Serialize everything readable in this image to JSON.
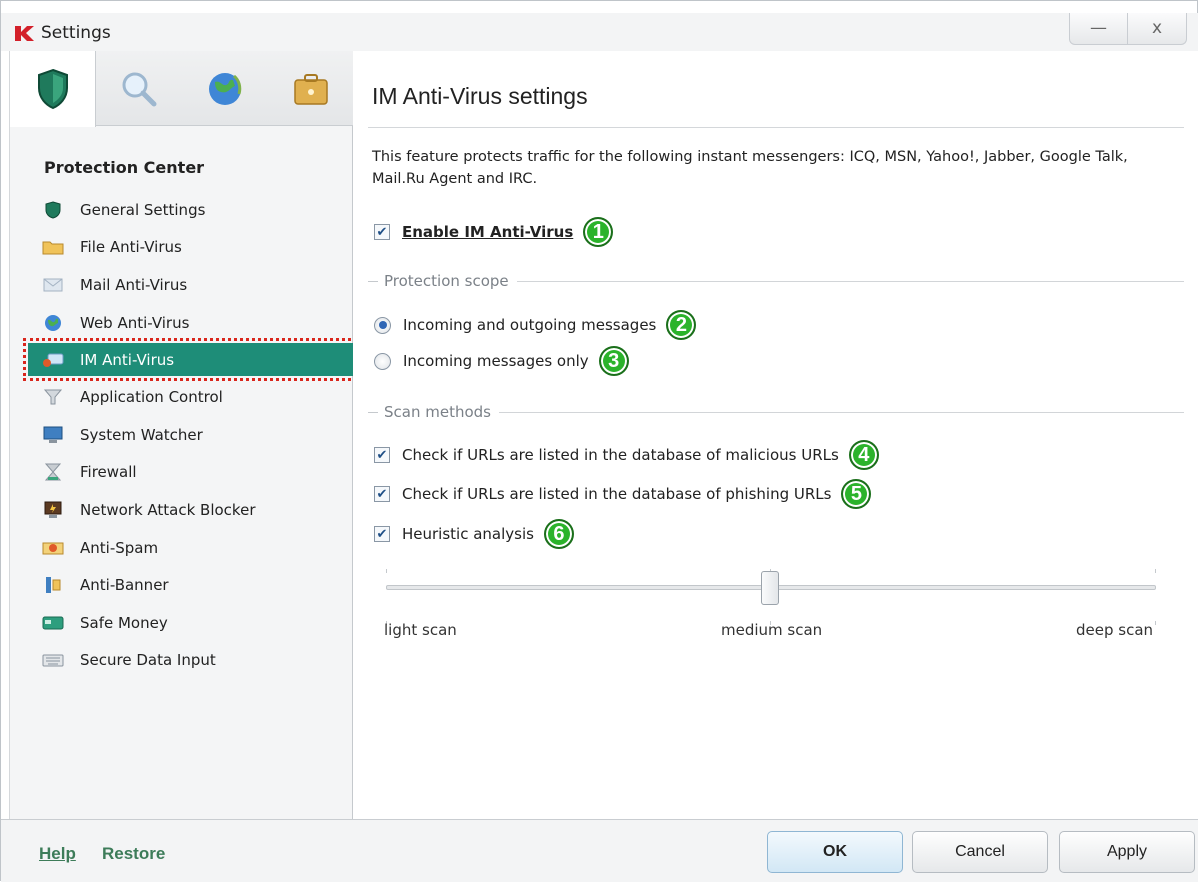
{
  "window": {
    "title": "Settings",
    "minimize": "—",
    "close": "x"
  },
  "sidebar": {
    "tabs": [
      {
        "icon": "shield-icon"
      },
      {
        "icon": "magnifier-icon"
      },
      {
        "icon": "globe-icon"
      },
      {
        "icon": "briefcase-icon"
      }
    ],
    "section_title": "Protection Center",
    "items": [
      {
        "label": "General Settings",
        "icon": "shield-icon"
      },
      {
        "label": "File Anti-Virus",
        "icon": "folder-icon"
      },
      {
        "label": "Mail Anti-Virus",
        "icon": "envelope-icon"
      },
      {
        "label": "Web Anti-Virus",
        "icon": "globe-icon"
      },
      {
        "label": "IM Anti-Virus",
        "icon": "chat-icon",
        "selected": true
      },
      {
        "label": "Application Control",
        "icon": "funnel-icon"
      },
      {
        "label": "System Watcher",
        "icon": "monitor-icon"
      },
      {
        "label": "Firewall",
        "icon": "hourglass-icon"
      },
      {
        "label": "Network Attack Blocker",
        "icon": "network-icon"
      },
      {
        "label": "Anti-Spam",
        "icon": "spam-icon"
      },
      {
        "label": "Anti-Banner",
        "icon": "banner-icon"
      },
      {
        "label": "Safe Money",
        "icon": "card-icon"
      },
      {
        "label": "Secure Data Input",
        "icon": "keyboard-icon"
      }
    ]
  },
  "main": {
    "title": "IM Anti-Virus settings",
    "description": "This feature protects traffic for the following instant messengers: ICQ, MSN, Yahoo!, Jabber, Google Talk, Mail.Ru Agent and IRC.",
    "enable": {
      "label": "Enable IM Anti-Virus",
      "checked": true,
      "badge": "1"
    },
    "protection_scope": {
      "label": "Protection scope",
      "options": [
        {
          "label": "Incoming and outgoing messages",
          "selected": true,
          "badge": "2"
        },
        {
          "label": "Incoming messages only",
          "selected": false,
          "badge": "3"
        }
      ]
    },
    "scan_methods": {
      "label": "Scan methods",
      "options": [
        {
          "label": "Check if URLs are listed in the database of malicious URLs",
          "checked": true,
          "badge": "4"
        },
        {
          "label": "Check if URLs are listed in the database of phishing URLs",
          "checked": true,
          "badge": "5"
        },
        {
          "label": "Heuristic analysis",
          "checked": true,
          "badge": "6"
        }
      ]
    },
    "scan_level": {
      "labels": [
        "light scan",
        "medium scan",
        "deep scan"
      ],
      "value": "medium scan"
    }
  },
  "footer": {
    "help": "Help",
    "restore": "Restore",
    "ok": "OK",
    "cancel": "Cancel",
    "apply": "Apply"
  }
}
